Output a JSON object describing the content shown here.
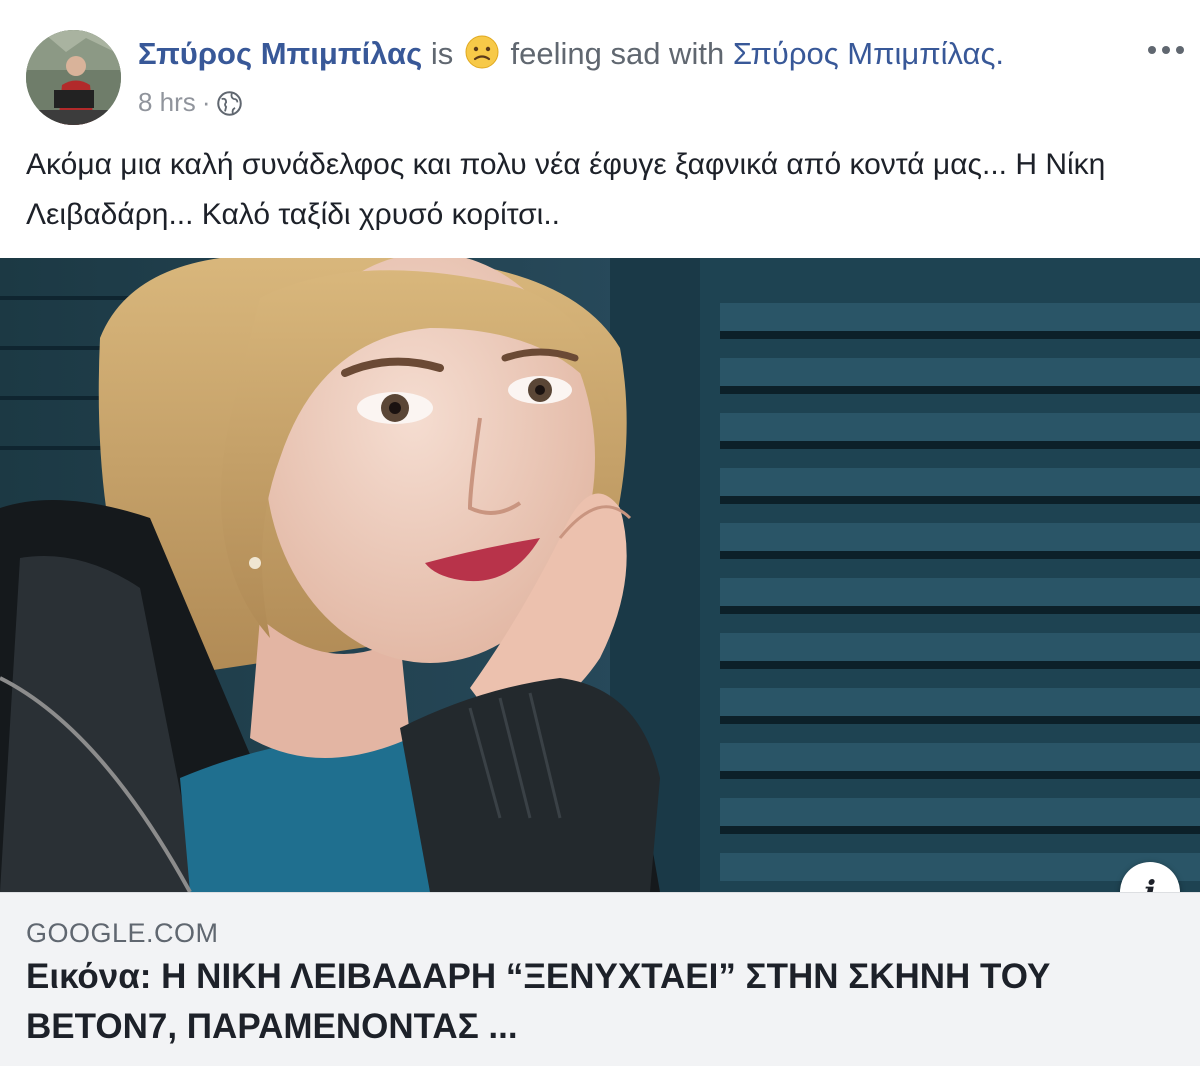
{
  "post": {
    "author": "Σπύρος Μπιμπίλας",
    "is_word": "is",
    "feeling_text": "feeling sad with",
    "tagged": "Σπύρος Μπιμπίλας.",
    "timestamp": "8 hrs",
    "separator": "·",
    "privacy_icon": "globe-icon",
    "more_icon": "ellipsis-icon",
    "feeling_icon": "sad-face-emoji-icon",
    "body": "Ακόμα μια καλή συνάδελφος και πολυ νέα έφυγε ξαφνικά από κοντά μας... Η Νίκη Λειβαδάρη... Καλό ταξίδι χρυσό κορίτσι.."
  },
  "link_preview": {
    "domain": "GOOGLE.COM",
    "title": "Εικόνα: Η ΝΙΚΗ ΛΕΙΒΑΔΑΡΗ “ΞΕΝΥΧΤΑΕΙ” ΣΤΗΝ ΣΚΗΝΗ ΤΟΥ ΒΕΤΟΝ7, ΠΑΡΑΜΕΝΟΝΤΑΣ ...",
    "info_label": "i",
    "info_icon": "info-icon"
  },
  "colors": {
    "name_link": "#385898",
    "meta_text": "#90949c",
    "link_box_bg": "#f2f3f5",
    "shutter_blue": "#1f4250"
  }
}
